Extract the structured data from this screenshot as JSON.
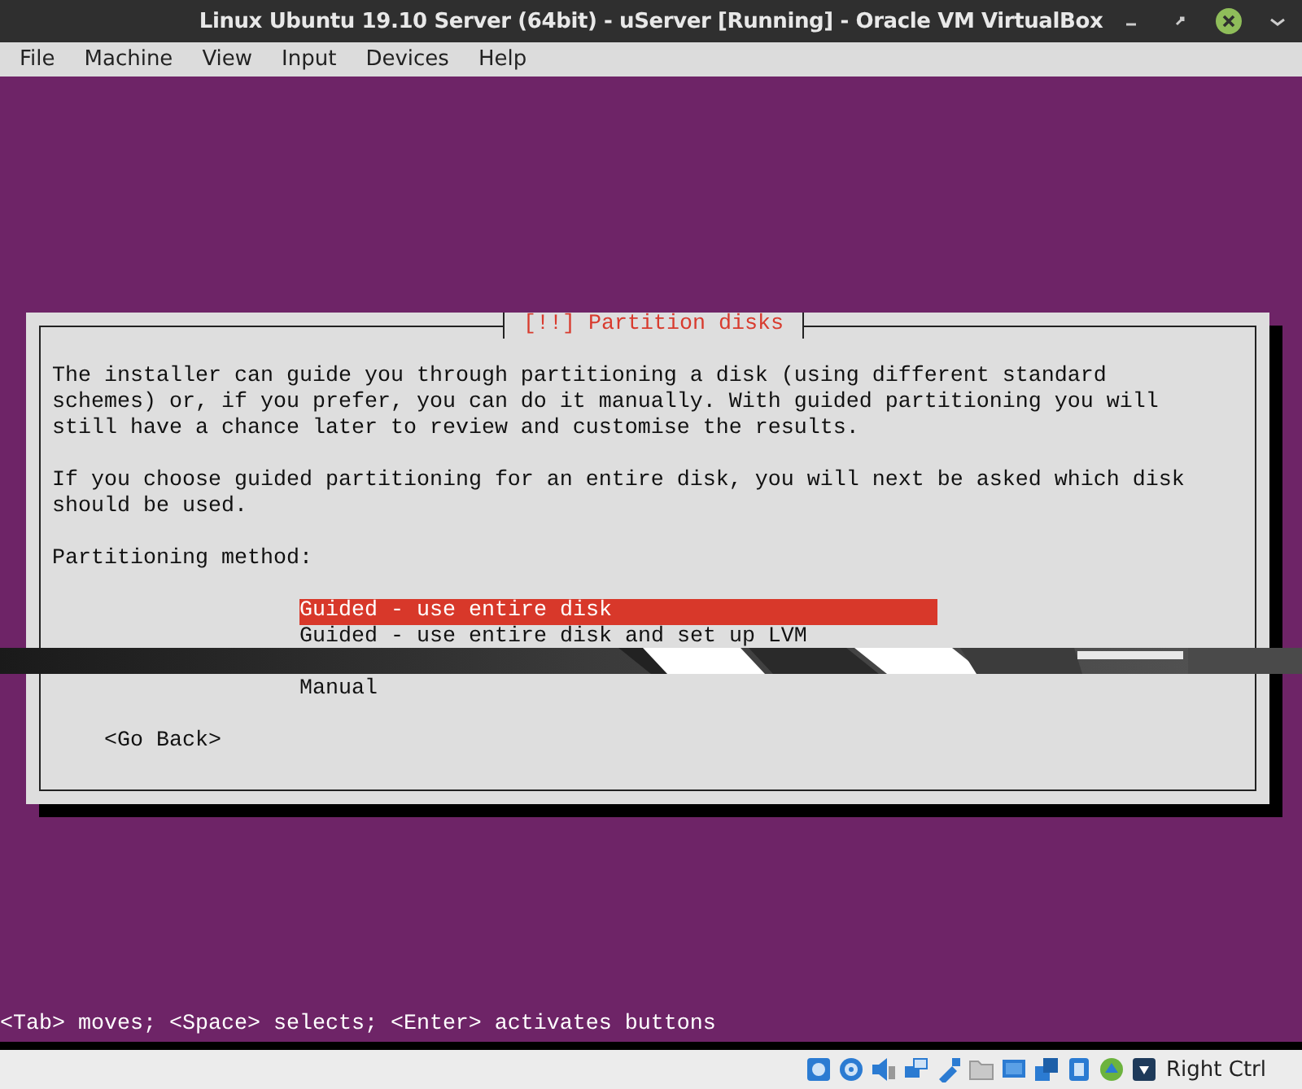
{
  "window": {
    "title": "Linux Ubuntu 19.10 Server (64bit) - uServer [Running] - Oracle VM VirtualBox"
  },
  "menu": [
    "File",
    "Machine",
    "View",
    "Input",
    "Devices",
    "Help"
  ],
  "dialog": {
    "title": "[!!] Partition disks",
    "paragraphs": [
      "The installer can guide you through partitioning a disk (using different standard schemes) or, if you prefer, you can do it manually. With guided partitioning you will still have a chance later to review and customise the results.",
      "If you choose guided partitioning for an entire disk, you will next be asked which disk should be used."
    ],
    "prompt": "Partitioning method:",
    "options": [
      {
        "label": "Guided - use entire disk",
        "selected": true
      },
      {
        "label": "Guided - use entire disk and set up LVM",
        "selected": false
      },
      {
        "kind": "picture"
      },
      {
        "label": "Manual",
        "selected": false
      }
    ],
    "back_button": "<Go Back>"
  },
  "help_line": "<Tab> moves; <Space> selects; <Enter> activates buttons",
  "status_bar": {
    "host_key": "Right Ctrl"
  }
}
